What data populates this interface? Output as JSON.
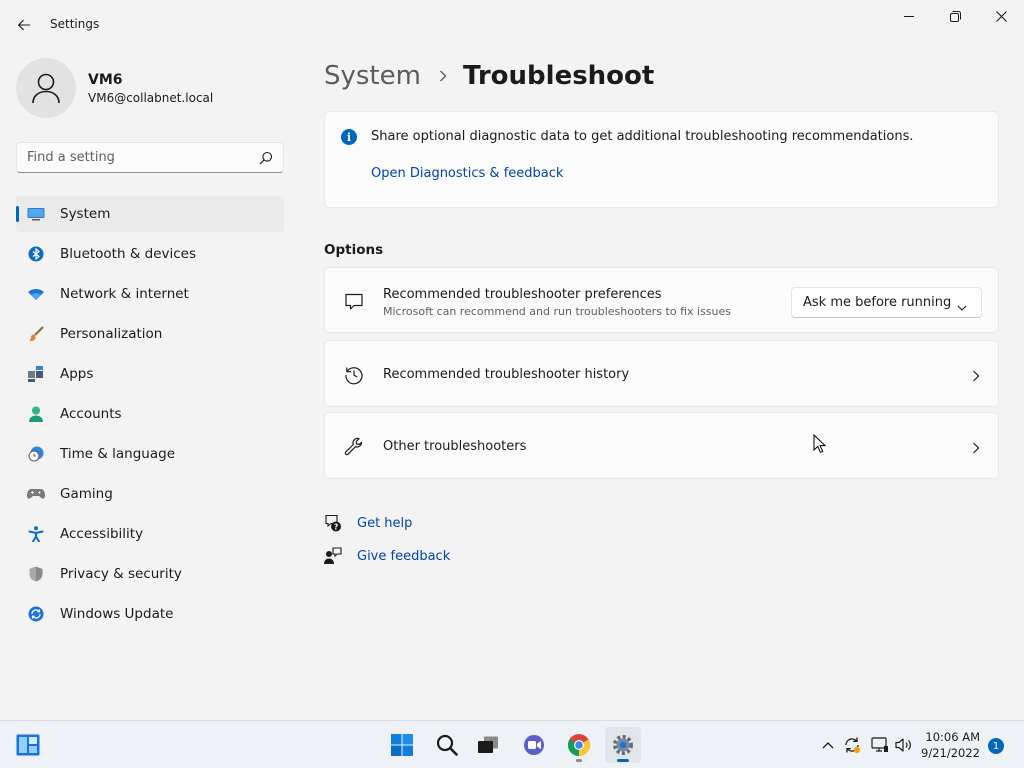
{
  "window": {
    "title": "Settings",
    "back_icon": "back-arrow-icon",
    "controls": [
      "minimize-icon",
      "restore-icon",
      "close-icon"
    ]
  },
  "profile": {
    "name": "VM6",
    "email": "VM6@collabnet.local",
    "avatar_icon": "person-icon"
  },
  "search": {
    "placeholder": "Find a setting",
    "icon": "search-icon"
  },
  "sidebar": {
    "items": [
      {
        "label": "System",
        "icon": "monitor-icon",
        "selected": true
      },
      {
        "label": "Bluetooth & devices",
        "icon": "bluetooth-icon"
      },
      {
        "label": "Network & internet",
        "icon": "wifi-icon"
      },
      {
        "label": "Personalization",
        "icon": "brush-icon"
      },
      {
        "label": "Apps",
        "icon": "apps-icon"
      },
      {
        "label": "Accounts",
        "icon": "account-icon"
      },
      {
        "label": "Time & language",
        "icon": "clock-globe-icon"
      },
      {
        "label": "Gaming",
        "icon": "gamepad-icon"
      },
      {
        "label": "Accessibility",
        "icon": "accessibility-icon"
      },
      {
        "label": "Privacy & security",
        "icon": "shield-icon"
      },
      {
        "label": "Windows Update",
        "icon": "update-icon"
      }
    ]
  },
  "main": {
    "breadcrumb": {
      "parent": "System",
      "current": "Troubleshoot"
    },
    "info": {
      "text": "Share optional diagnostic data to get additional troubleshooting recommendations.",
      "link": "Open Diagnostics & feedback"
    },
    "options_title": "Options",
    "rows": {
      "preferences": {
        "title": "Recommended troubleshooter preferences",
        "subtitle": "Microsoft can recommend and run troubleshooters to fix issues",
        "dropdown_value": "Ask me before running"
      },
      "history": {
        "title": "Recommended troubleshooter history"
      },
      "other": {
        "title": "Other troubleshooters"
      }
    },
    "help": {
      "get_help": "Get help",
      "give_feedback": "Give feedback"
    }
  },
  "taskbar": {
    "apps": [
      "widgets-icon",
      "start-icon",
      "search-icon",
      "task-view-icon",
      "chat-icon",
      "chrome-icon",
      "settings-icon"
    ],
    "active_app": "settings-icon",
    "tray": [
      "chevron-up-icon",
      "sync-icon",
      "network-icon",
      "volume-icon"
    ],
    "time": "10:06 AM",
    "date": "9/21/2022",
    "notification_count": "1"
  },
  "colors": {
    "accent": "#0067c0",
    "link": "#0046a6",
    "background": "#f3f3f3",
    "card": "#fbfbfb"
  }
}
